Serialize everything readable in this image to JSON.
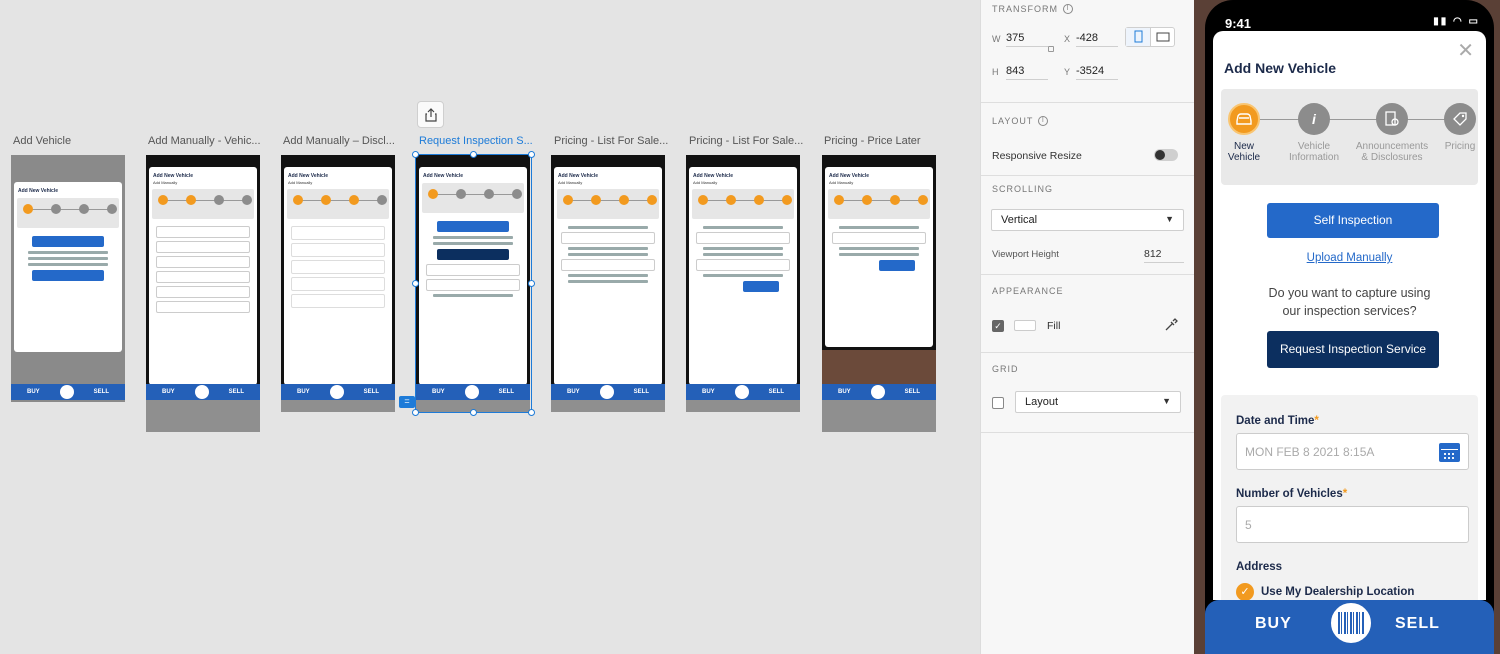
{
  "canvas": {
    "artboards": [
      {
        "label": "Add Vehicle",
        "selected": false
      },
      {
        "label": "Add Manually - Vehic...",
        "selected": false
      },
      {
        "label": "Add Manually – Discl...",
        "selected": false
      },
      {
        "label": "Request Inspection S...",
        "selected": true
      },
      {
        "label": "Pricing - List For Sale...",
        "selected": false
      },
      {
        "label": "Pricing - List For Sale...",
        "selected": false
      },
      {
        "label": "Pricing - Price Later",
        "selected": false
      }
    ],
    "tab_buy": "BUY",
    "tab_sell": "SELL",
    "share_icon": "share-icon"
  },
  "inspector": {
    "transform": {
      "title": "TRANSFORM",
      "w_label": "W",
      "w_value": "375",
      "x_label": "X",
      "x_value": "-428",
      "h_label": "H",
      "h_value": "843",
      "y_label": "Y",
      "y_value": "-3524"
    },
    "layout": {
      "title": "LAYOUT",
      "responsive_resize_label": "Responsive Resize",
      "responsive_resize_on": false
    },
    "scrolling": {
      "title": "SCROLLING",
      "mode": "Vertical",
      "viewport_height_label": "Viewport Height",
      "viewport_height_value": "812"
    },
    "appearance": {
      "title": "APPEARANCE",
      "fill_label": "Fill",
      "fill_checked": true,
      "fill_color": "#ffffff"
    },
    "grid": {
      "title": "GRID",
      "mode": "Layout",
      "checked": false
    }
  },
  "preview": {
    "status_time": "9:41",
    "sheet_title": "Add New Vehicle",
    "steps": [
      {
        "label_line1": "New",
        "label_line2": "Vehicle",
        "active": true,
        "icon": "car-icon"
      },
      {
        "label_line1": "Vehicle",
        "label_line2": "Information",
        "active": false,
        "icon": "info-icon"
      },
      {
        "label_line1": "Announcements",
        "label_line2": "& Disclosures",
        "active": false,
        "icon": "document-gear-icon"
      },
      {
        "label_line1": "Pricing",
        "label_line2": "",
        "active": false,
        "icon": "price-tag-icon"
      }
    ],
    "self_inspection_label": "Self Inspection",
    "upload_manually_label": "Upload Manually",
    "question_line1": "Do you want to capture using",
    "question_line2": "our inspection services?",
    "request_inspection_label": "Request Inspection Service",
    "date_time_label": "Date and Time",
    "date_time_placeholder": "MON FEB 8 2021 8:15A",
    "num_vehicles_label": "Number of Vehicles",
    "num_vehicles_placeholder": "5",
    "address_label": "Address",
    "use_dealership_label": "Use My Dealership Location",
    "tab_buy": "BUY",
    "tab_sell": "SELL",
    "accent_orange": "#f29a1f",
    "accent_blue": "#2469c9",
    "navy": "#0c2f5f"
  }
}
